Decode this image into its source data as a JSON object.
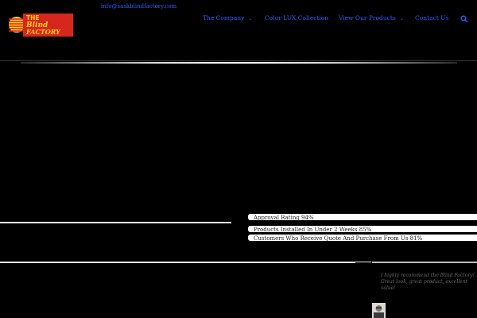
{
  "header": {
    "logo_text_line1": "THE",
    "logo_text_line2": "Blind",
    "logo_text_line3": "FACTORY",
    "email": "info@saskblindfactory.com"
  },
  "nav": {
    "items": [
      {
        "label": "The Company",
        "has_dropdown": true
      },
      {
        "label": "Color LUX Collection",
        "has_dropdown": false
      },
      {
        "label": "View Our Products",
        "has_dropdown": true
      },
      {
        "label": "Contact Us",
        "has_dropdown": false
      }
    ],
    "search_icon": "search-icon",
    "chevron": "⌄"
  },
  "stats": [
    {
      "label": "Approval Rating 94%",
      "value": 94
    },
    {
      "label": "Products Installed In Under 2 Weeks  85%",
      "value": 85
    },
    {
      "label": "Customers Who Receive Quote And Purchase From Us 81%",
      "value": 81
    }
  ],
  "testimonial": {
    "quote": "I highly recommend the Blind Factory! Great look, great product, excellent value!"
  },
  "colors": {
    "background": "#000000",
    "link": "#2f5cff",
    "logo_red": "#d7261e",
    "logo_yellow": "#ffd21f"
  }
}
